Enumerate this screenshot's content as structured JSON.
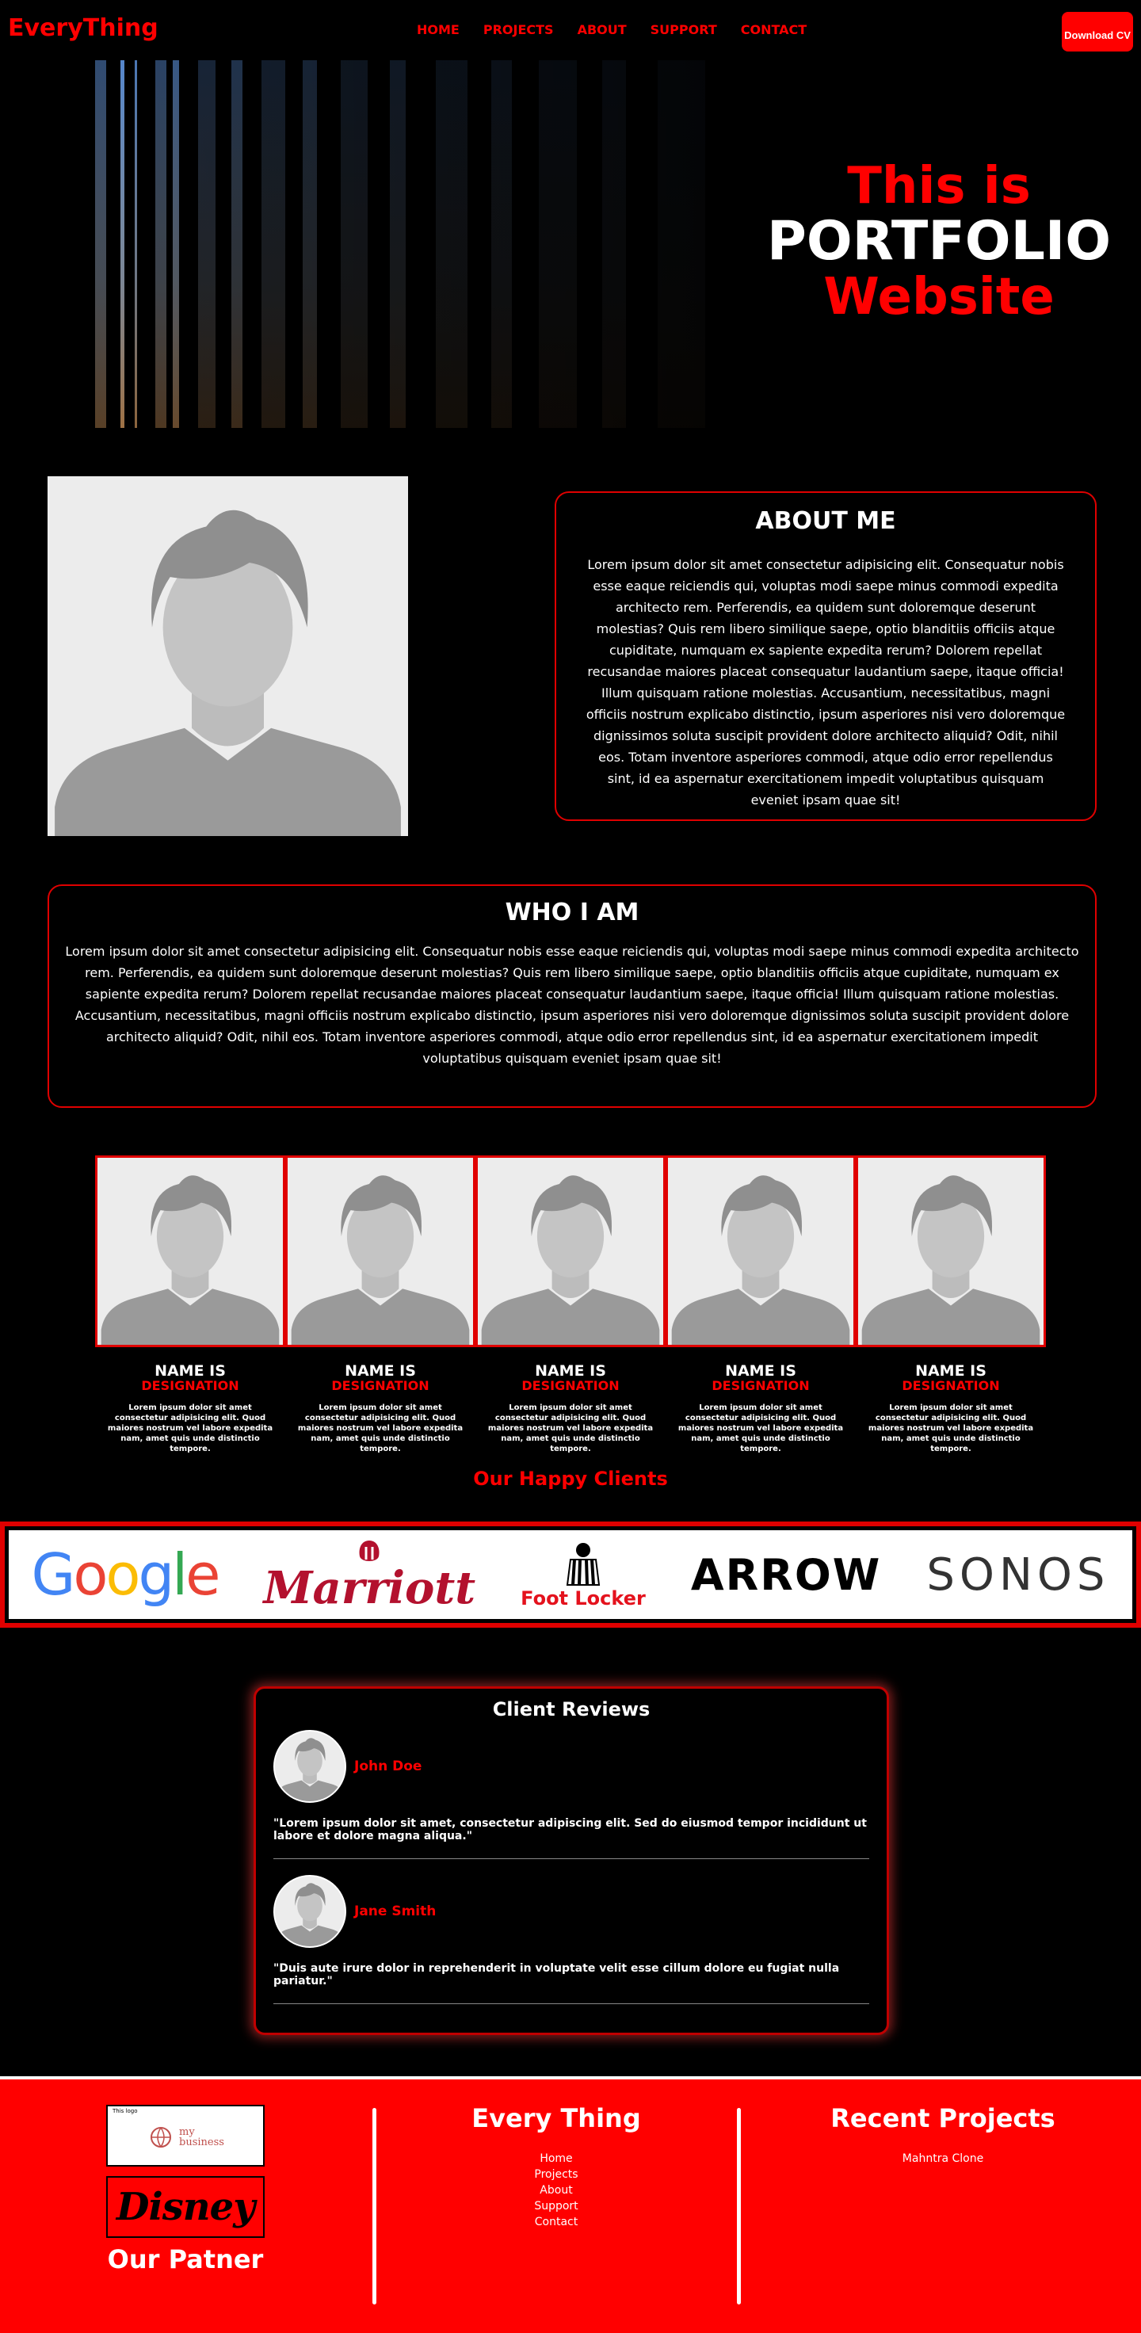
{
  "nav": {
    "brand": "EveryThing",
    "links": [
      "HOME",
      "PROJECTS",
      "ABOUT",
      "SUPPORT",
      "CONTACT"
    ],
    "cv_button": "Download CV"
  },
  "hero": {
    "line1": "This is",
    "line2": "PORTFOLIO",
    "line3": "Website"
  },
  "about": {
    "title": "ABOUT ME",
    "text": "Lorem ipsum dolor sit amet consectetur adipisicing elit. Consequatur nobis esse eaque reiciendis qui, voluptas modi saepe minus commodi expedita architecto rem. Perferendis, ea quidem sunt doloremque deserunt molestias? Quis rem libero similique saepe, optio blanditiis officiis atque cupiditate, numquam ex sapiente expedita rerum? Dolorem repellat recusandae maiores placeat consequatur laudantium saepe, itaque officia! Illum quisquam ratione molestias. Accusantium, necessitatibus, magni officiis nostrum explicabo distinctio, ipsum asperiores nisi vero doloremque dignissimos soluta suscipit provident dolore architecto aliquid? Odit, nihil eos. Totam inventore asperiores commodi, atque odio error repellendus sint, id ea aspernatur exercitationem impedit voluptatibus quisquam eveniet ipsam quae sit!"
  },
  "who": {
    "title": "WHO I AM",
    "text": "Lorem ipsum dolor sit amet consectetur adipisicing elit. Consequatur nobis esse eaque reiciendis qui, voluptas modi saepe minus commodi expedita architecto rem. Perferendis, ea quidem sunt doloremque deserunt molestias? Quis rem libero similique saepe, optio blanditiis officiis atque cupiditate, numquam ex sapiente expedita rerum? Dolorem repellat recusandae maiores placeat consequatur laudantium saepe, itaque officia! Illum quisquam ratione molestias. Accusantium, necessitatibus, magni officiis nostrum explicabo distinctio, ipsum asperiores nisi vero doloremque dignissimos soluta suscipit provident dolore architecto aliquid? Odit, nihil eos. Totam inventore asperiores commodi, atque odio error repellendus sint, id ea aspernatur exercitationem impedit voluptatibus quisquam eveniet ipsam quae sit!"
  },
  "team": [
    {
      "name": "NAME IS",
      "designation": "DESIGNATION",
      "text": "Lorem ipsum dolor sit amet consectetur adipisicing elit. Quod maiores nostrum vel labore expedita nam, amet quis unde distinctio tempore."
    },
    {
      "name": "NAME IS",
      "designation": "DESIGNATION",
      "text": "Lorem ipsum dolor sit amet consectetur adipisicing elit. Quod maiores nostrum vel labore expedita nam, amet quis unde distinctio tempore."
    },
    {
      "name": "NAME IS",
      "designation": "DESIGNATION",
      "text": "Lorem ipsum dolor sit amet consectetur adipisicing elit. Quod maiores nostrum vel labore expedita nam, amet quis unde distinctio tempore."
    },
    {
      "name": "NAME IS",
      "designation": "DESIGNATION",
      "text": "Lorem ipsum dolor sit amet consectetur adipisicing elit. Quod maiores nostrum vel labore expedita nam, amet quis unde distinctio tempore."
    },
    {
      "name": "NAME IS",
      "designation": "DESIGNATION",
      "text": "Lorem ipsum dolor sit amet consectetur adipisicing elit. Quod maiores nostrum vel labore expedita nam, amet quis unde distinctio tempore."
    }
  ],
  "clients": {
    "title": "Our Happy Clients",
    "logos": {
      "google": "Google",
      "marriott": "Marriott",
      "footlocker": "Foot Locker",
      "arrow": "ARROW",
      "sonos": "SONOS"
    }
  },
  "reviews": {
    "title": "Client Reviews",
    "items": [
      {
        "name": "John Doe",
        "text": "\"Lorem ipsum dolor sit amet, consectetur adipiscing elit. Sed do eiusmod tempor incididunt ut labore et dolore magna aliqua.\""
      },
      {
        "name": "Jane Smith",
        "text": "\"Duis aute irure dolor in reprehenderit in voluptate velit esse cillum dolore eu fugiat nulla pariatur.\""
      }
    ]
  },
  "footer": {
    "partner_tiny": "This logo",
    "partner_my": "my",
    "partner_business": "business",
    "partner_disney": "Disney",
    "partners_title": "Our Patner",
    "col2_title": "Every Thing",
    "col2_links": [
      "Home",
      "Projects",
      "About",
      "Support",
      "Contact"
    ],
    "col3_title": "Recent Projects",
    "col3_links": [
      "Mahntra Clone"
    ]
  },
  "colors": {
    "accent": "#ff0000",
    "background": "#000000",
    "text": "#ffffff"
  }
}
